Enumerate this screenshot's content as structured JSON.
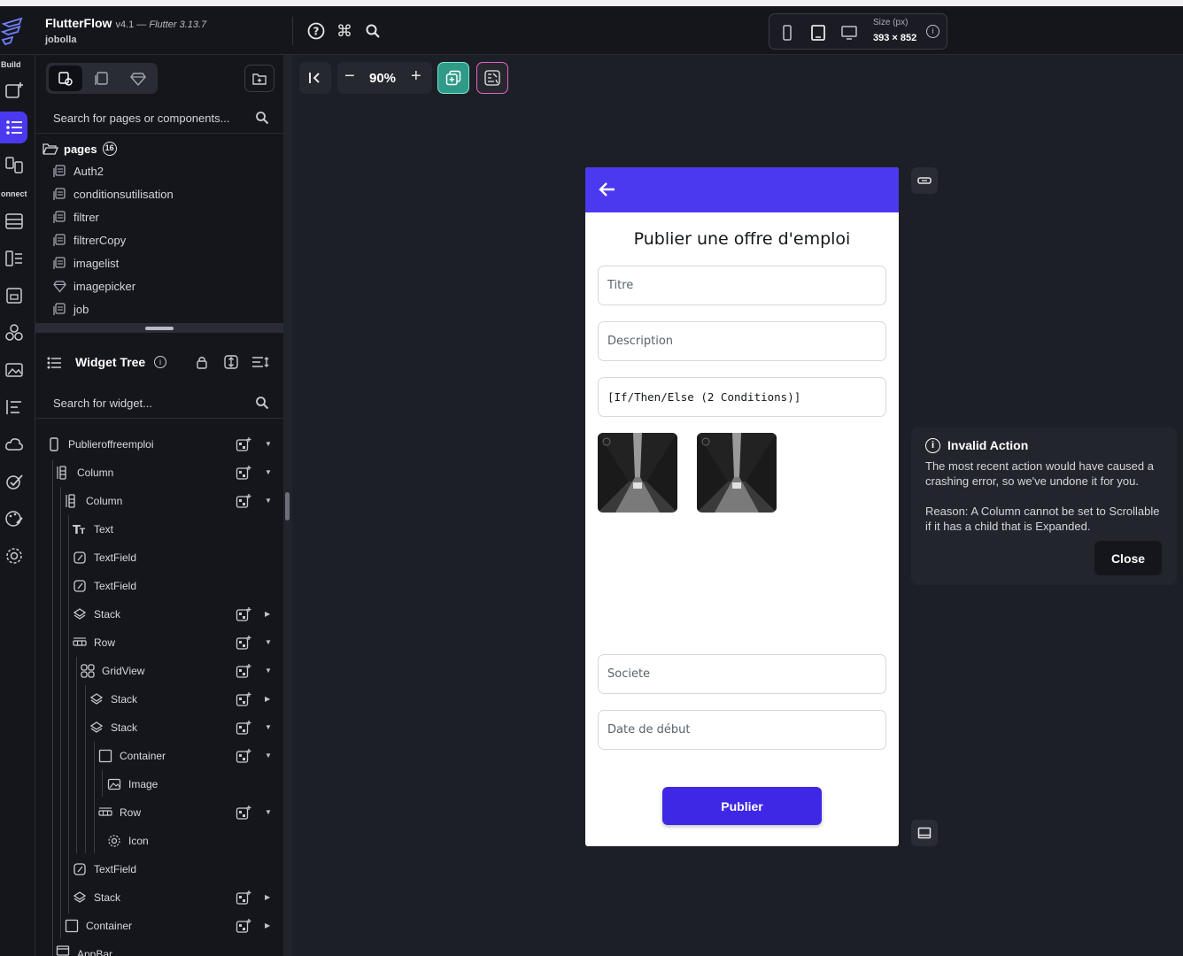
{
  "app": {
    "name": "FlutterFlow",
    "version": "v4.1 —",
    "flutter_version": "Flutter 3.13.7",
    "project": "jobolla"
  },
  "device": {
    "size_label": "Size (px)",
    "size_value": "393 × 852"
  },
  "rail": {
    "build_label": "Build",
    "connect_label": "onnect"
  },
  "pages_panel": {
    "search_placeholder": "Search for pages or components...",
    "folder_label": "pages",
    "folder_count": "16",
    "items": [
      "Auth2",
      "conditionsutilisation",
      "filtrer",
      "filtrerCopy",
      "imagelist",
      "imagepicker",
      "job"
    ]
  },
  "widget_tree": {
    "title": "Widget Tree",
    "search_placeholder": "Search for widget...",
    "items": [
      {
        "label": "Publieroffreemploi"
      },
      {
        "label": "Column"
      },
      {
        "label": "Column"
      },
      {
        "label": "Text"
      },
      {
        "label": "TextField"
      },
      {
        "label": "TextField"
      },
      {
        "label": "Stack"
      },
      {
        "label": "Row"
      },
      {
        "label": "GridView"
      },
      {
        "label": "Stack"
      },
      {
        "label": "Stack"
      },
      {
        "label": "Container"
      },
      {
        "label": "Image"
      },
      {
        "label": "Row"
      },
      {
        "label": "Icon"
      },
      {
        "label": "TextField"
      },
      {
        "label": "Stack"
      },
      {
        "label": "Container"
      },
      {
        "label": "AppBar"
      }
    ]
  },
  "canvas": {
    "zoom": "90%"
  },
  "preview": {
    "title": "Publier une offre d'emploi",
    "fields": {
      "titre": "Titre",
      "description": "Description",
      "conditional": "[If/Then/Else (2 Conditions)]",
      "societe": "Societe",
      "date": "Date de début"
    },
    "publish_label": "Publier",
    "appbar_color": "#4B39EF"
  },
  "toast": {
    "title": "Invalid Action",
    "message": "The most recent action would have caused a crashing error, so we've undone it for you.",
    "reason": "Reason: A Column cannot be set to Scrollable if it has a child that is Expanded.",
    "close_label": "Close"
  }
}
